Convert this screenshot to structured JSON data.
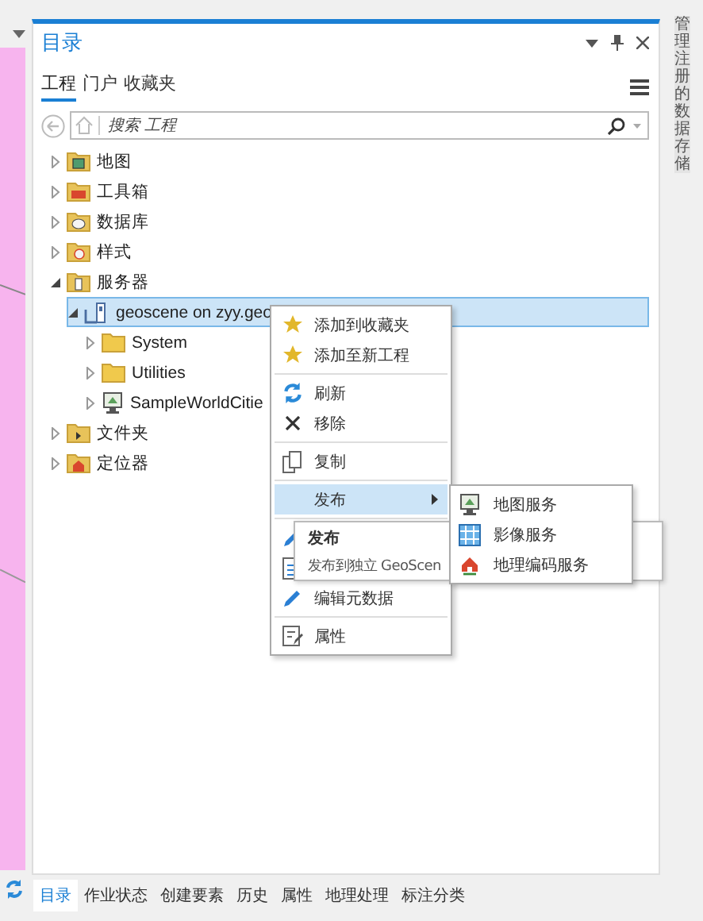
{
  "panel": {
    "title": "目录"
  },
  "tabs": [
    {
      "label": "工程",
      "selected": true
    },
    {
      "label": "门户",
      "selected": false
    },
    {
      "label": "收藏夹",
      "selected": false
    }
  ],
  "search": {
    "placeholder": "搜索 工程"
  },
  "tree": [
    {
      "label": "地图",
      "kind": "map",
      "expanded": false,
      "selected": false
    },
    {
      "label": "工具箱",
      "kind": "toolbox",
      "expanded": false,
      "selected": false
    },
    {
      "label": "数据库",
      "kind": "database",
      "expanded": false,
      "selected": false
    },
    {
      "label": "样式",
      "kind": "style",
      "expanded": false,
      "selected": false
    },
    {
      "label": "服务器",
      "kind": "server",
      "expanded": true,
      "selected": false,
      "children": [
        {
          "label": "geoscene on zyy.geo",
          "kind": "connection",
          "expanded": true,
          "selected": true,
          "children": [
            {
              "label": "System",
              "kind": "folder",
              "expanded": false,
              "selected": false
            },
            {
              "label": "Utilities",
              "kind": "folder",
              "expanded": false,
              "selected": false
            },
            {
              "label": "SampleWorldCitie",
              "kind": "service",
              "expanded": false,
              "selected": false
            }
          ]
        }
      ]
    },
    {
      "label": "文件夹",
      "kind": "files",
      "expanded": false,
      "selected": false
    },
    {
      "label": "定位器",
      "kind": "locator",
      "expanded": false,
      "selected": false
    }
  ],
  "context_menu": [
    {
      "kind": "favorite",
      "label": "添加到收藏夹",
      "selected": false
    },
    {
      "kind": "favorite",
      "label": "添加至新工程",
      "selected": false
    },
    {
      "kind": "separator"
    },
    {
      "kind": "refresh",
      "label": "刷新",
      "selected": false
    },
    {
      "kind": "remove",
      "label": "移除",
      "selected": false
    },
    {
      "kind": "separator"
    },
    {
      "kind": "copy",
      "label": "复制",
      "selected": false
    },
    {
      "kind": "separator"
    },
    {
      "kind": "submenu",
      "label": "发布",
      "selected": true
    },
    {
      "kind": "separator"
    },
    {
      "kind": "edit",
      "selected": false
    },
    {
      "kind": "document",
      "selected": false
    },
    {
      "kind": "edit",
      "label": "编辑元数据",
      "selected": false
    },
    {
      "kind": "separator"
    },
    {
      "kind": "properties",
      "label": "属性",
      "selected": false
    }
  ],
  "submenu": [
    {
      "kind": "map",
      "label": "地图服务"
    },
    {
      "label": "影像服务"
    },
    {
      "kind": "geocode",
      "label": "地理编码服务"
    }
  ],
  "tooltip": {
    "title": "发布",
    "text": "发布到独立 GeoScen"
  },
  "side_tab": "管理注册的数据存储",
  "bottom_tabs": [
    {
      "label": "目录",
      "selected": true
    },
    {
      "label": "作业状态",
      "selected": false
    },
    {
      "label": "创建要素",
      "selected": false
    },
    {
      "label": "历史",
      "selected": false
    },
    {
      "label": "属性",
      "selected": false
    },
    {
      "label": "地理处理",
      "selected": false
    },
    {
      "label": "标注分类",
      "selected": false
    }
  ]
}
